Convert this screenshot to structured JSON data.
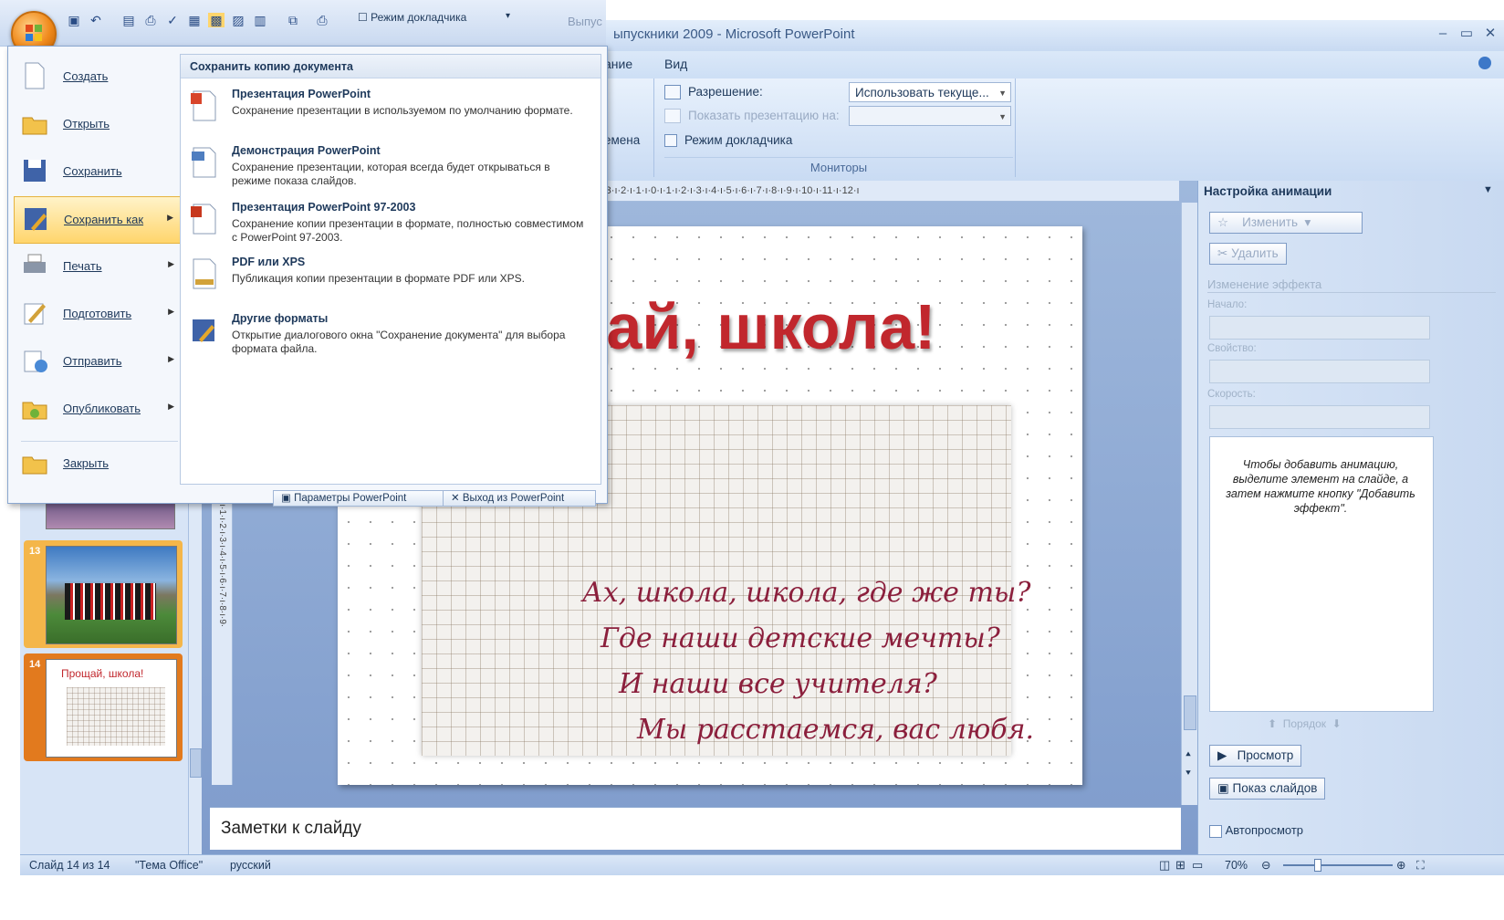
{
  "window": {
    "title": "ыпускники 2009 - Microsoft PowerPoint",
    "qat_title_fragment": "Выпус",
    "controls": [
      "–",
      "▭",
      "✕"
    ]
  },
  "ribbon": {
    "tabs": [
      "ание",
      "Вид"
    ],
    "left_fragment": "емена",
    "resolution_label": "Разрешение:",
    "resolution_value": "Использовать текуще...",
    "show_on_label": "Показать презентацию на:",
    "presenter_label": "Режим докладчика",
    "group_label": "Мониторы"
  },
  "qat": {
    "presenter_mode": "Режим докладчика"
  },
  "office_menu": {
    "items": [
      {
        "label": "Создать",
        "has_submenu": false,
        "icon": "new-doc-icon"
      },
      {
        "label": "Открыть",
        "has_submenu": false,
        "icon": "open-folder-icon"
      },
      {
        "label": "Сохранить",
        "has_submenu": false,
        "icon": "save-disk-icon"
      },
      {
        "label": "Сохранить как",
        "has_submenu": true,
        "icon": "save-as-icon",
        "selected": true
      },
      {
        "label": "Печать",
        "has_submenu": true,
        "icon": "printer-icon"
      },
      {
        "label": "Подготовить",
        "has_submenu": true,
        "icon": "prepare-icon"
      },
      {
        "label": "Отправить",
        "has_submenu": true,
        "icon": "send-icon"
      },
      {
        "label": "Опубликовать",
        "has_submenu": true,
        "icon": "publish-icon"
      },
      {
        "label": "Закрыть",
        "has_submenu": false,
        "icon": "close-folder-icon"
      }
    ],
    "submenu_title": "Сохранить копию документа",
    "submenu": [
      {
        "title": "Презентация PowerPoint",
        "desc": "Сохранение презентации в используемом по умолчанию формате."
      },
      {
        "title": "Демонстрация PowerPoint",
        "desc": "Сохранение презентации, которая всегда будет открываться в режиме показа слайдов."
      },
      {
        "title": "Презентация PowerPoint 97-2003",
        "desc": "Сохранение копии презентации в формате, полностью совместимом с PowerPoint 97-2003."
      },
      {
        "title": "PDF или XPS",
        "desc": "Публикация копии презентации в формате PDF или XPS."
      },
      {
        "title": "Другие форматы",
        "desc": "Открытие диалогового окна \"Сохранение документа\" для выбора формата файла."
      }
    ],
    "footer": {
      "options": "Параметры PowerPoint",
      "exit": "Выход из PowerPoint"
    }
  },
  "slides_pane": {
    "thumbs": [
      {
        "number": "13",
        "caption": ""
      },
      {
        "number": "14",
        "caption": "Прощай, школа!"
      }
    ]
  },
  "ruler": {
    "horizontal": "·3·ı·2·ı·1·ı·0·ı·1·ı·2·ı·3·ı·4·ı·5·ı·6·ı·7·ı·8·ı·9·ı·10·ı·11·ı·12·ı",
    "vertical": "·0·ı·1·ı·2·ı·3·ı·4·ı·5·ı·6·ı·7·ı·8·ı·9·"
  },
  "slide": {
    "title": "дай, школа!",
    "poem": [
      "Ах, школа, школа, где же ты?",
      "Где наши детские мечты?",
      "И наши все учителя?",
      "Мы расстаемся, вас любя."
    ]
  },
  "notes": {
    "placeholder": "Заметки к слайду"
  },
  "task_pane": {
    "title": "Настройка анимации",
    "change_button": "Изменить",
    "delete_button": "Удалить",
    "effect_section": "Изменение эффекта",
    "start_label": "Начало:",
    "property_label": "Свойство:",
    "speed_label": "Скорость:",
    "hint": "Чтобы добавить анимацию, выделите элемент на слайде, а затем нажмите кнопку \"Добавить эффект\".",
    "order_label": "Порядок",
    "preview_button": "Просмотр",
    "slideshow_button": "Показ слайдов",
    "autopreview_label": "Автопросмотр"
  },
  "status": {
    "slide": "Слайд 14 из 14",
    "theme": "\"Тема Office\"",
    "language": "русский",
    "zoom": "70%",
    "zoom_fraction": 0.3
  },
  "colors": {
    "title_red": "#c1272d",
    "poem_burgundy": "#8b1f3c",
    "ribbon_blue": "#c9dbf3",
    "menu_highlight": "#ffd56c"
  }
}
